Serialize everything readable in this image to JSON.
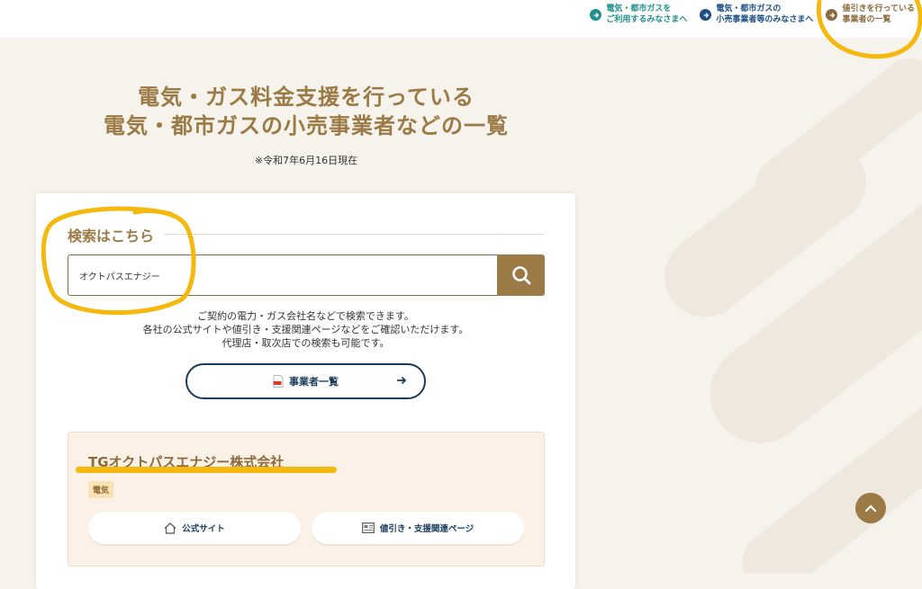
{
  "header": {
    "nav": [
      {
        "line1": "電気・都市ガスを",
        "line2": "ご利用するみなさまへ"
      },
      {
        "line1": "電気・都市ガスの",
        "line2": "小売事業者等のみなさまへ"
      },
      {
        "line1": "値引きを行っている",
        "line2": "事業者の一覧"
      }
    ]
  },
  "page": {
    "title_line1": "電気・ガス料金支援を行っている",
    "title_line2": "電気・都市ガスの小売事業者などの一覧",
    "as_of": "※令和7年6月16日現在"
  },
  "search": {
    "heading": "検索はこちら",
    "value": "オクトパスエナジー",
    "help_lines": [
      "ご契約の電力・ガス会社名などで検索できます。",
      "各社の公式サイトや値引き・支援関連ページなどをご確認いただけます。",
      "代理店・取次店での検索も可能です。"
    ],
    "list_button": "事業者一覧"
  },
  "result": {
    "company": "TGオクトパスエナジー株式会社",
    "tag": "電気",
    "official_site": "公式サイト",
    "discount_page": "値引き・支援関連ページ"
  },
  "colors": {
    "accent": "#9b7a45",
    "navy": "#1a3c5a",
    "teal": "#1f8f8d",
    "annotation": "#f4b80e"
  }
}
